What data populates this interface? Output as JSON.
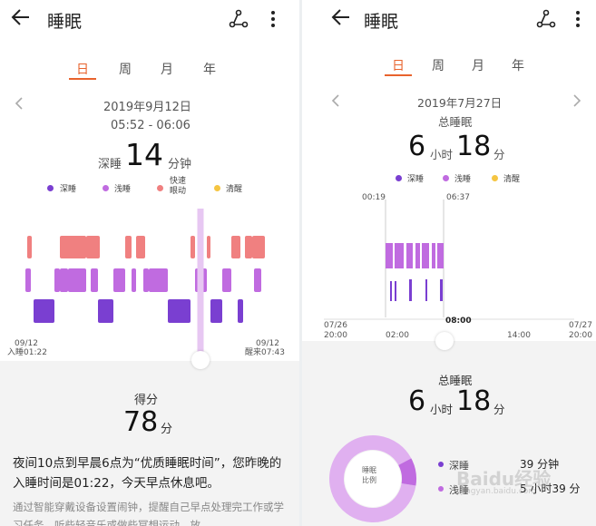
{
  "left": {
    "header": {
      "title": "睡眠",
      "share_icon": "share-icon",
      "more_icon": "more-vertical-icon"
    },
    "tabs": [
      {
        "label": "日",
        "active": true
      },
      {
        "label": "周"
      },
      {
        "label": "月"
      },
      {
        "label": "年"
      }
    ],
    "date": "2019年9月12日",
    "time_range": "05:52 - 06:06",
    "stage_label": "深睡",
    "stage_value": "14",
    "stage_unit": "分钟",
    "legend": [
      {
        "label": "深睡",
        "color": "#7a3fd1"
      },
      {
        "label": "浅睡",
        "color": "#c06be0"
      },
      {
        "label": "快速\n眼动",
        "color": "#f08080"
      },
      {
        "label": "清醒",
        "color": "#f5c542"
      }
    ],
    "chart_data": {
      "type": "bar",
      "levels": [
        "深睡",
        "浅睡",
        "快速眼动"
      ],
      "start_label": [
        "09/12",
        "入睡01:22"
      ],
      "end_label": [
        "09/12",
        "醒来07:43"
      ]
    },
    "score_label": "得分",
    "score_value": "78",
    "score_unit": "分",
    "advice": "夜间10点到早晨6点为“优质睡眠时间”，您昨晚的入睡时间是01:22，今天早点休息吧。",
    "tip": "通过智能穿戴设备设置闹钟，提醒自己早点处理完工作或学习任务，听些轻音乐或做些冥想运动，放"
  },
  "right": {
    "header": {
      "title": "睡眠",
      "share_icon": "share-icon",
      "more_icon": "more-vertical-icon"
    },
    "tabs": [
      {
        "label": "日",
        "active": true
      },
      {
        "label": "周"
      },
      {
        "label": "月"
      },
      {
        "label": "年"
      }
    ],
    "date": "2019年7月27日",
    "total_label": "总睡眠",
    "hours": "6",
    "hours_unit": "小时",
    "minutes": "18",
    "minutes_unit": "分",
    "legend": [
      {
        "label": "深睡",
        "color": "#7a3fd1"
      },
      {
        "label": "浅睡",
        "color": "#c06be0"
      },
      {
        "label": "清醒",
        "color": "#f5c542"
      }
    ],
    "chart": {
      "marker_start": "00:19",
      "marker_end": "06:37",
      "x_ticks": [
        "07/26\n20:00",
        "02:00",
        "08:00",
        "14:00",
        "07/27\n20:00"
      ]
    },
    "summary_label": "总睡眠",
    "summary_hours": "6",
    "summary_hours_unit": "小时",
    "summary_minutes": "18",
    "summary_minutes_unit": "分",
    "donut_label": "睡眠\n比例",
    "donut_data": {
      "type": "pie",
      "values": [
        39,
        339
      ],
      "labels": [
        "深睡",
        "浅睡"
      ],
      "colors": [
        "#c06be0",
        "#e0b0f0"
      ]
    },
    "breakdown": [
      {
        "label": "深睡",
        "value": "39 分钟",
        "color": "#7a3fd1"
      },
      {
        "label": "浅睡",
        "value": "5 小时39 分",
        "color": "#c06be0"
      }
    ],
    "watermark": "Baidu经验",
    "watermark_url": "jingyan.baidu.com"
  }
}
